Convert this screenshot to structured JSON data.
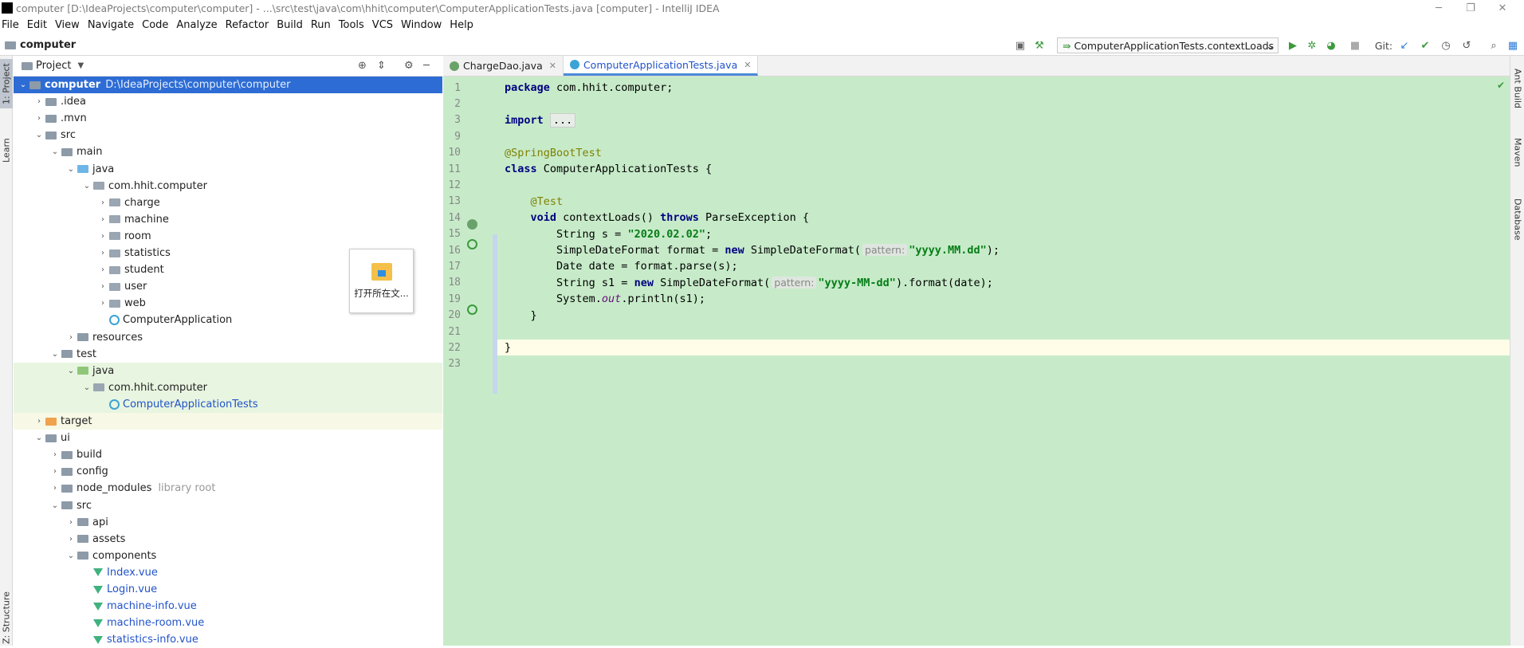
{
  "window": {
    "title": "computer [D:\\IdeaProjects\\computer\\computer] - ...\\src\\test\\java\\com\\hhit\\computer\\ComputerApplicationTests.java [computer] - IntelliJ IDEA"
  },
  "menu": [
    "File",
    "Edit",
    "View",
    "Navigate",
    "Code",
    "Analyze",
    "Refactor",
    "Build",
    "Run",
    "Tools",
    "VCS",
    "Window",
    "Help"
  ],
  "navbar": {
    "crumb": "computer",
    "run_config": "ComputerApplicationTests.contextLoads",
    "git_label": "Git:"
  },
  "left_tabs": {
    "project": "1: Project",
    "learn": "Learn",
    "structure": "Z: Structure"
  },
  "right_tabs": {
    "ant": "Ant Build",
    "maven": "Maven",
    "database": "Database"
  },
  "project_panel": {
    "header": "Project",
    "tree": [
      {
        "label": "computer",
        "hint": "D:\\IdeaProjects\\computer\\computer",
        "arrow": "open",
        "icon": "module",
        "bold": true,
        "selected": true
      },
      {
        "label": ".idea",
        "arrow": "closed",
        "icon": "folder"
      },
      {
        "label": ".mvn",
        "arrow": "closed",
        "icon": "folder"
      },
      {
        "label": "src",
        "arrow": "open",
        "icon": "folder"
      },
      {
        "label": "main",
        "arrow": "open",
        "icon": "folder"
      },
      {
        "label": "java",
        "arrow": "open",
        "icon": "source-folder"
      },
      {
        "label": "com.hhit.computer",
        "arrow": "open",
        "icon": "package"
      },
      {
        "label": "charge",
        "arrow": "closed",
        "icon": "package"
      },
      {
        "label": "machine",
        "arrow": "closed",
        "icon": "package"
      },
      {
        "label": "room",
        "arrow": "closed",
        "icon": "package"
      },
      {
        "label": "statistics",
        "arrow": "closed",
        "icon": "package"
      },
      {
        "label": "student",
        "arrow": "closed",
        "icon": "package"
      },
      {
        "label": "user",
        "arrow": "closed",
        "icon": "package"
      },
      {
        "label": "web",
        "arrow": "closed",
        "icon": "package"
      },
      {
        "label": "ComputerApplication",
        "arrow": "none",
        "icon": "class"
      },
      {
        "label": "resources",
        "arrow": "closed",
        "icon": "resources-folder"
      },
      {
        "label": "test",
        "arrow": "open",
        "icon": "folder"
      },
      {
        "label": "java",
        "arrow": "open",
        "icon": "test-folder",
        "test": true
      },
      {
        "label": "com.hhit.computer",
        "arrow": "open",
        "icon": "package",
        "test": true
      },
      {
        "label": "ComputerApplicationTests",
        "arrow": "none",
        "icon": "class",
        "test": true,
        "blue": true
      },
      {
        "label": "target",
        "arrow": "closed",
        "icon": "excluded-folder",
        "excluded": true
      },
      {
        "label": "ui",
        "arrow": "open",
        "icon": "folder"
      },
      {
        "label": "build",
        "arrow": "closed",
        "icon": "folder"
      },
      {
        "label": "config",
        "arrow": "closed",
        "icon": "folder"
      },
      {
        "label": "node_modules",
        "hint": "library root",
        "arrow": "closed",
        "icon": "folder"
      },
      {
        "label": "src",
        "arrow": "open",
        "icon": "folder"
      },
      {
        "label": "api",
        "arrow": "closed",
        "icon": "folder"
      },
      {
        "label": "assets",
        "arrow": "closed",
        "icon": "folder"
      },
      {
        "label": "components",
        "arrow": "open",
        "icon": "folder"
      },
      {
        "label": "Index.vue",
        "arrow": "none",
        "icon": "vue",
        "blue": true
      },
      {
        "label": "Login.vue",
        "arrow": "none",
        "icon": "vue",
        "blue": true
      },
      {
        "label": "machine-info.vue",
        "arrow": "none",
        "icon": "vue",
        "blue": true
      },
      {
        "label": "machine-room.vue",
        "arrow": "none",
        "icon": "vue",
        "blue": true
      },
      {
        "label": "statistics-info.vue",
        "arrow": "none",
        "icon": "vue",
        "blue": true
      }
    ]
  },
  "popup": {
    "label": "打开所在文..."
  },
  "editor": {
    "tabs": [
      {
        "label": "ChargeDao.java",
        "active": false
      },
      {
        "label": "ComputerApplicationTests.java",
        "active": true
      }
    ],
    "lines": [
      {
        "n": "1",
        "html": "<span class=\"kw\">package</span> com.hhit.computer;"
      },
      {
        "n": "2",
        "html": ""
      },
      {
        "n": "3",
        "html": "<span class=\"kw\">import</span> <span class=\"fold\">...</span>"
      },
      {
        "n": "9",
        "html": ""
      },
      {
        "n": "10",
        "html": "<span class=\"ann\">@SpringBootTest</span>"
      },
      {
        "n": "11",
        "html": "<span class=\"kw\">class</span> ComputerApplicationTests {"
      },
      {
        "n": "12",
        "html": ""
      },
      {
        "n": "13",
        "html": "    <span class=\"ann\">@Test</span>"
      },
      {
        "n": "14",
        "html": "    <span class=\"kw\">void</span> contextLoads() <span class=\"kw\">throws</span> ParseException {"
      },
      {
        "n": "15",
        "html": "        String s = <span class=\"str\">\"2020.02.02\"</span>;"
      },
      {
        "n": "16",
        "html": "        SimpleDateFormat format = <span class=\"kw\">new</span> SimpleDateFormat(<span class=\"inlay\">pattern:</span><span class=\"str\">\"yyyy.MM.dd\"</span>);"
      },
      {
        "n": "17",
        "html": "        Date date = format.parse(s);"
      },
      {
        "n": "18",
        "html": "        String s1 = <span class=\"kw\">new</span> SimpleDateFormat(<span class=\"inlay\">pattern:</span><span class=\"str\">\"yyyy-MM-dd\"</span>).format(date);"
      },
      {
        "n": "19",
        "html": "        System.<span class=\"it\">out</span>.println(s1);"
      },
      {
        "n": "20",
        "html": "    }"
      },
      {
        "n": "21",
        "html": ""
      },
      {
        "n": "22",
        "html": "}"
      },
      {
        "n": "23",
        "html": ""
      }
    ]
  }
}
